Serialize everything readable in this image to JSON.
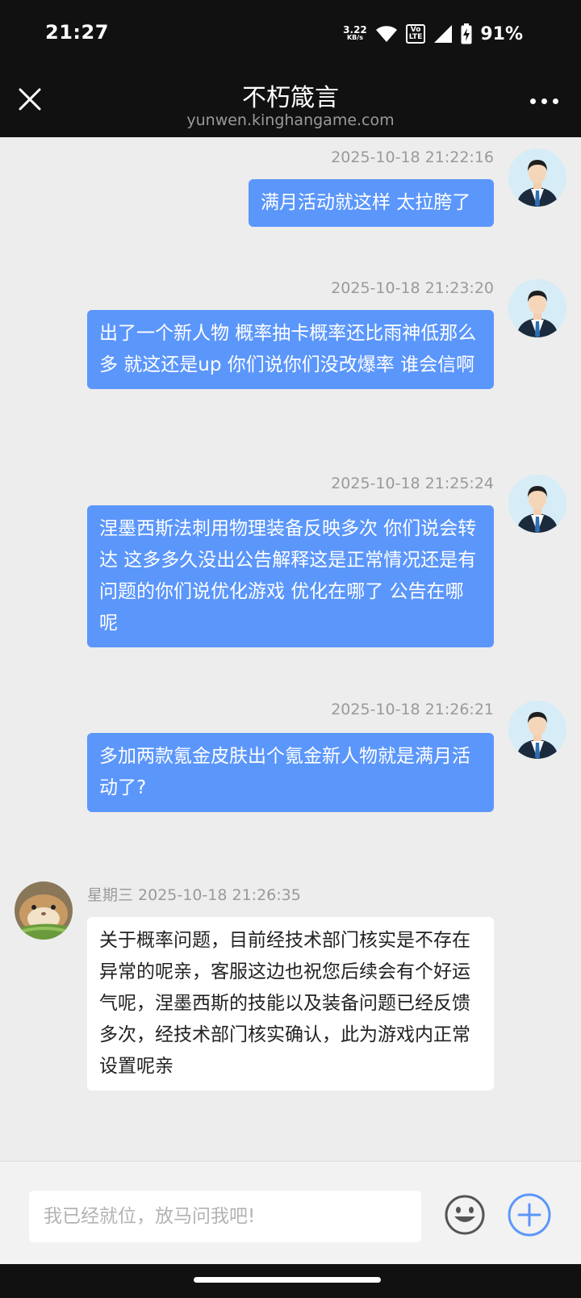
{
  "status_bar": {
    "time": "21:27",
    "net_speed_value": "3.22",
    "net_speed_unit": "KB/s",
    "volte_top": "Vo",
    "volte_bottom": "LTE",
    "battery": "91%"
  },
  "header": {
    "title": "不朽箴言",
    "subtitle": "yunwen.kinghangame.com"
  },
  "messages": [
    {
      "side": "user",
      "timestamp": "2025-10-18 21:22:16",
      "text": "满月活动就这样 太拉胯了"
    },
    {
      "side": "user",
      "timestamp": "2025-10-18 21:23:20",
      "text": "出了一个新人物 概率抽卡概率还比雨神低那么多 就这还是up 你们说你们没改爆率 谁会信啊"
    },
    {
      "side": "user",
      "timestamp": "2025-10-18 21:25:24",
      "text": "涅墨西斯法刺用物理装备反映多次 你们说会转达 这多多久没出公告解释这是正常情况还是有问题的你们说优化游戏 优化在哪了 公告在哪呢"
    },
    {
      "side": "user",
      "timestamp": "2025-10-18 21:26:21",
      "text": "多加两款氪金皮肤出个氪金新人物就是满月活动了?"
    },
    {
      "side": "agent",
      "timestamp": "星期三 2025-10-18 21:26:35",
      "text": "关于概率问题，目前经技术部门核实是不存在异常的呢亲，客服这边也祝您后续会有个好运气呢，涅墨西斯的技能以及装备问题已经反馈多次，经技术部门核实确认，此为游戏内正常设置呢亲"
    }
  ],
  "input": {
    "placeholder": "我已经就位，放马问我吧!"
  },
  "colors": {
    "user_bubble": "#5b96fb",
    "accent": "#5b96fb",
    "chat_background": "#ededed"
  }
}
